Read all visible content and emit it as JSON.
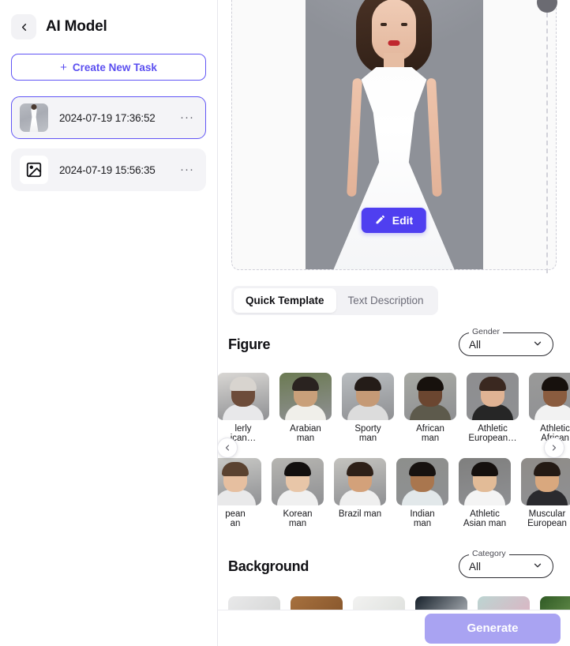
{
  "sidebar": {
    "back_icon": "chevron-left-icon",
    "title": "AI Model",
    "create_button": {
      "plus": "+",
      "label": "Create New Task"
    },
    "tasks": [
      {
        "date": "2024-07-19 17:36:52",
        "thumb": "dress-photo",
        "more": "···",
        "selected": true
      },
      {
        "date": "2024-07-19 15:56:35",
        "thumb": "image-placeholder-icon",
        "more": "···",
        "selected": false
      }
    ]
  },
  "preview": {
    "edit_button": {
      "label": "Edit",
      "icon": "pencil-icon"
    },
    "compare_handle": "compare-slider-handle"
  },
  "tabs": [
    {
      "label": "Quick Template",
      "active": true
    },
    {
      "label": "Text Description",
      "active": false
    }
  ],
  "figure": {
    "title": "Figure",
    "filter": {
      "label": "Gender",
      "value": "All",
      "chevron": "chevron-down-icon"
    },
    "prev_arrow": "chevron-left-icon",
    "next_arrow": "chevron-right-icon",
    "row1": [
      {
        "label_line1": "lerly",
        "label_line2": "ican…",
        "skin": "#6d4c3a",
        "hair": "#d8d4cf",
        "body": "#e8e8ea",
        "bg": "#d9d7d4"
      },
      {
        "label_line1": "Arabian",
        "label_line2": "man",
        "skin": "#c9a07a",
        "hair": "#2a2320",
        "body": "#f0efea",
        "bg": "#6b7a52"
      },
      {
        "label_line1": "Sporty",
        "label_line2": "man",
        "skin": "#c59a76",
        "hair": "#241c18",
        "body": "#dcdcdc",
        "bg": "#b9bdc0"
      },
      {
        "label_line1": "African",
        "label_line2": "man",
        "skin": "#6b4630",
        "hair": "#17110d",
        "body": "#5d5a4c",
        "bg": "#a7a9a3"
      },
      {
        "label_line1": "Athletic",
        "label_line2": "European…",
        "skin": "#e0b394",
        "hair": "#3a2820",
        "body": "#262626",
        "bg": "#8e8e90"
      },
      {
        "label_line1": "Athletic",
        "label_line2": "African",
        "skin": "#8a5c3f",
        "hair": "#17110d",
        "body": "#f2f2f2",
        "bg": "#9a9a99"
      }
    ],
    "row2": [
      {
        "label_line1": "pean",
        "label_line2": "an",
        "skin": "#e6bfa0",
        "hair": "#5a4230",
        "body": "#e9e9ea",
        "bg": "#c9c9c6"
      },
      {
        "label_line1": "Korean",
        "label_line2": "man",
        "skin": "#e8c6a8",
        "hair": "#120f0e",
        "body": "#f0f0f0",
        "bg": "#b6b5b1"
      },
      {
        "label_line1": "Brazil man",
        "label_line2": "",
        "skin": "#d3a17a",
        "hair": "#2e2018",
        "body": "#efefef",
        "bg": "#c4c3bf"
      },
      {
        "label_line1": "Indian",
        "label_line2": "man",
        "skin": "#a9764e",
        "hair": "#171210",
        "body": "#e2e8ea",
        "bg": "#8d8f8c"
      },
      {
        "label_line1": "Athletic",
        "label_line2": "Asian man",
        "skin": "#e2bb97",
        "hair": "#15100e",
        "body": "#f4f4f4",
        "bg": "#7f7f7e"
      },
      {
        "label_line1": "Muscular",
        "label_line2": "European",
        "skin": "#d9a87e",
        "hair": "#241a14",
        "body": "#2a2a2e",
        "bg": "#8f8c88"
      }
    ]
  },
  "background": {
    "title": "Background",
    "filter": {
      "label": "Category",
      "value": "All",
      "chevron": "chevron-down-icon"
    },
    "items": [
      {
        "c1": "#e9e9ea",
        "c2": "#cfd0cf"
      },
      {
        "c1": "#a7713f",
        "c2": "#7b4c24"
      },
      {
        "c1": "#f2f2f1",
        "c2": "#d7dad6"
      },
      {
        "c1": "#16202a",
        "c2": "#e3e6ea"
      },
      {
        "c1": "#bcd5d2",
        "c2": "#e7a8bd"
      },
      {
        "c1": "#2f5a24",
        "c2": "#8fb56a"
      }
    ]
  },
  "footer": {
    "generate_label": "Generate"
  }
}
